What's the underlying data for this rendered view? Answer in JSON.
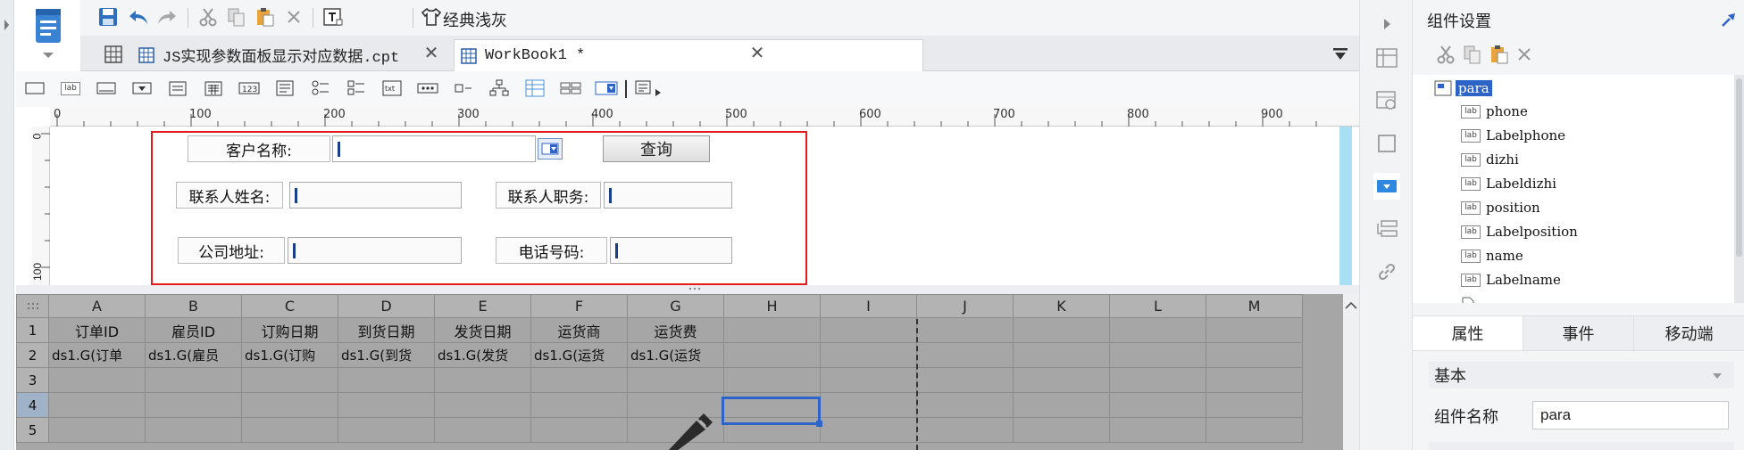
{
  "toolbar": {
    "theme_label": "经典浅灰"
  },
  "tabs": [
    {
      "label": "JS实现参数面板显示对应数据.cpt",
      "active": false
    },
    {
      "label": "WorkBook1 *",
      "active": true
    }
  ],
  "ruler": {
    "h_labels": [
      "0",
      "100",
      "200",
      "300",
      "400",
      "500",
      "600",
      "700",
      "800",
      "900"
    ],
    "v_labels": [
      "0",
      "100"
    ]
  },
  "param_panel": {
    "customer_label": "客户名称:",
    "query_label": "查询",
    "contact_name_label": "联系人姓名:",
    "contact_title_label": "联系人职务:",
    "address_label": "公司地址:",
    "phone_label": "电话号码:"
  },
  "grid": {
    "columns": [
      "A",
      "B",
      "C",
      "D",
      "E",
      "F",
      "G",
      "H",
      "I",
      "J",
      "K",
      "L",
      "M"
    ],
    "rows": [
      "1",
      "2",
      "3",
      "4",
      "5"
    ],
    "row1": [
      "订单ID",
      "雇员ID",
      "订购日期",
      "到货日期",
      "发货日期",
      "运货商",
      "运货费"
    ],
    "row2": [
      "ds1.G(订单",
      "ds1.G(雇员",
      "ds1.G(订购",
      "ds1.G(到货",
      "ds1.G(发货",
      "ds1.G(运货",
      "ds1.G(运货"
    ]
  },
  "right_panel": {
    "title": "组件设置",
    "tree_root": "para",
    "tree_items": [
      "phone",
      "Labelphone",
      "dizhi",
      "Labeldizhi",
      "position",
      "Labelposition",
      "name",
      "Labelname"
    ],
    "tabs": [
      "属性",
      "事件",
      "移动端"
    ],
    "section_basic": "基本",
    "component_name_label": "组件名称",
    "component_name_value": "para"
  },
  "colors": {
    "accent": "#2e63c8",
    "highlight_border": "#e31b1b",
    "brand_blue": "#1f69b5"
  }
}
